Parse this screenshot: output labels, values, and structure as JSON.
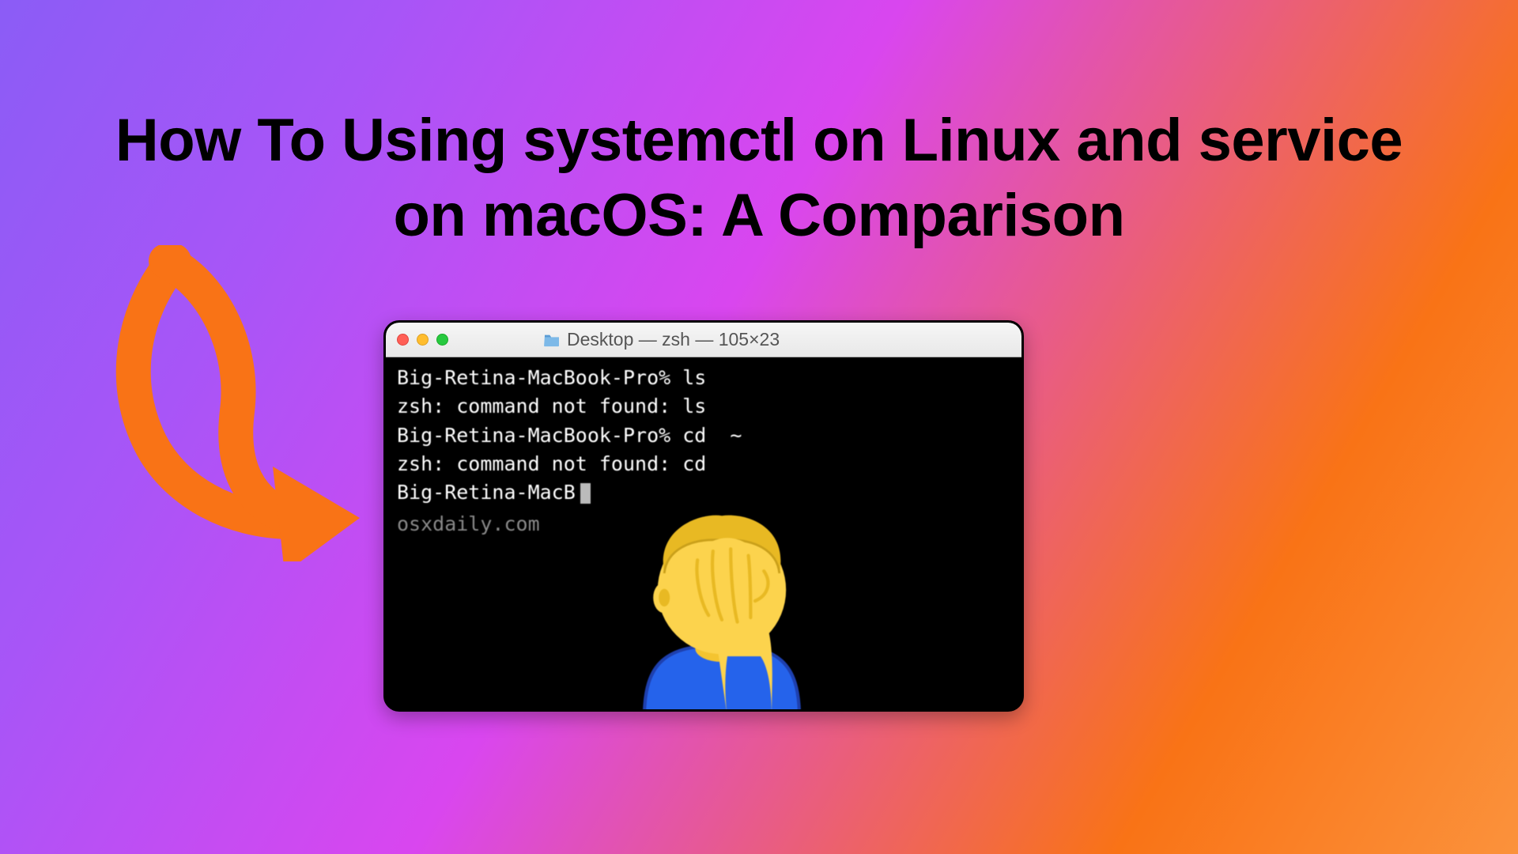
{
  "headline": "How To Using systemctl on Linux and service on macOS: A Comparison",
  "terminal": {
    "title": "Desktop — zsh — 105×23",
    "lines": [
      "Big-Retina-MacBook-Pro% ls",
      "zsh: command not found: ls",
      "Big-Retina-MacBook-Pro% cd  ~",
      "zsh: command not found: cd",
      "Big-Retina-MacB"
    ],
    "watermark": "osxdaily.com"
  },
  "colors": {
    "arrow": "#f97316",
    "traffic_red": "#ff5f56",
    "traffic_yellow": "#ffbd2e",
    "traffic_green": "#27c93f"
  },
  "icons": {
    "arrow": "curved-arrow-icon",
    "facepalm": "facepalm-emoji-icon",
    "folder": "folder-icon"
  }
}
